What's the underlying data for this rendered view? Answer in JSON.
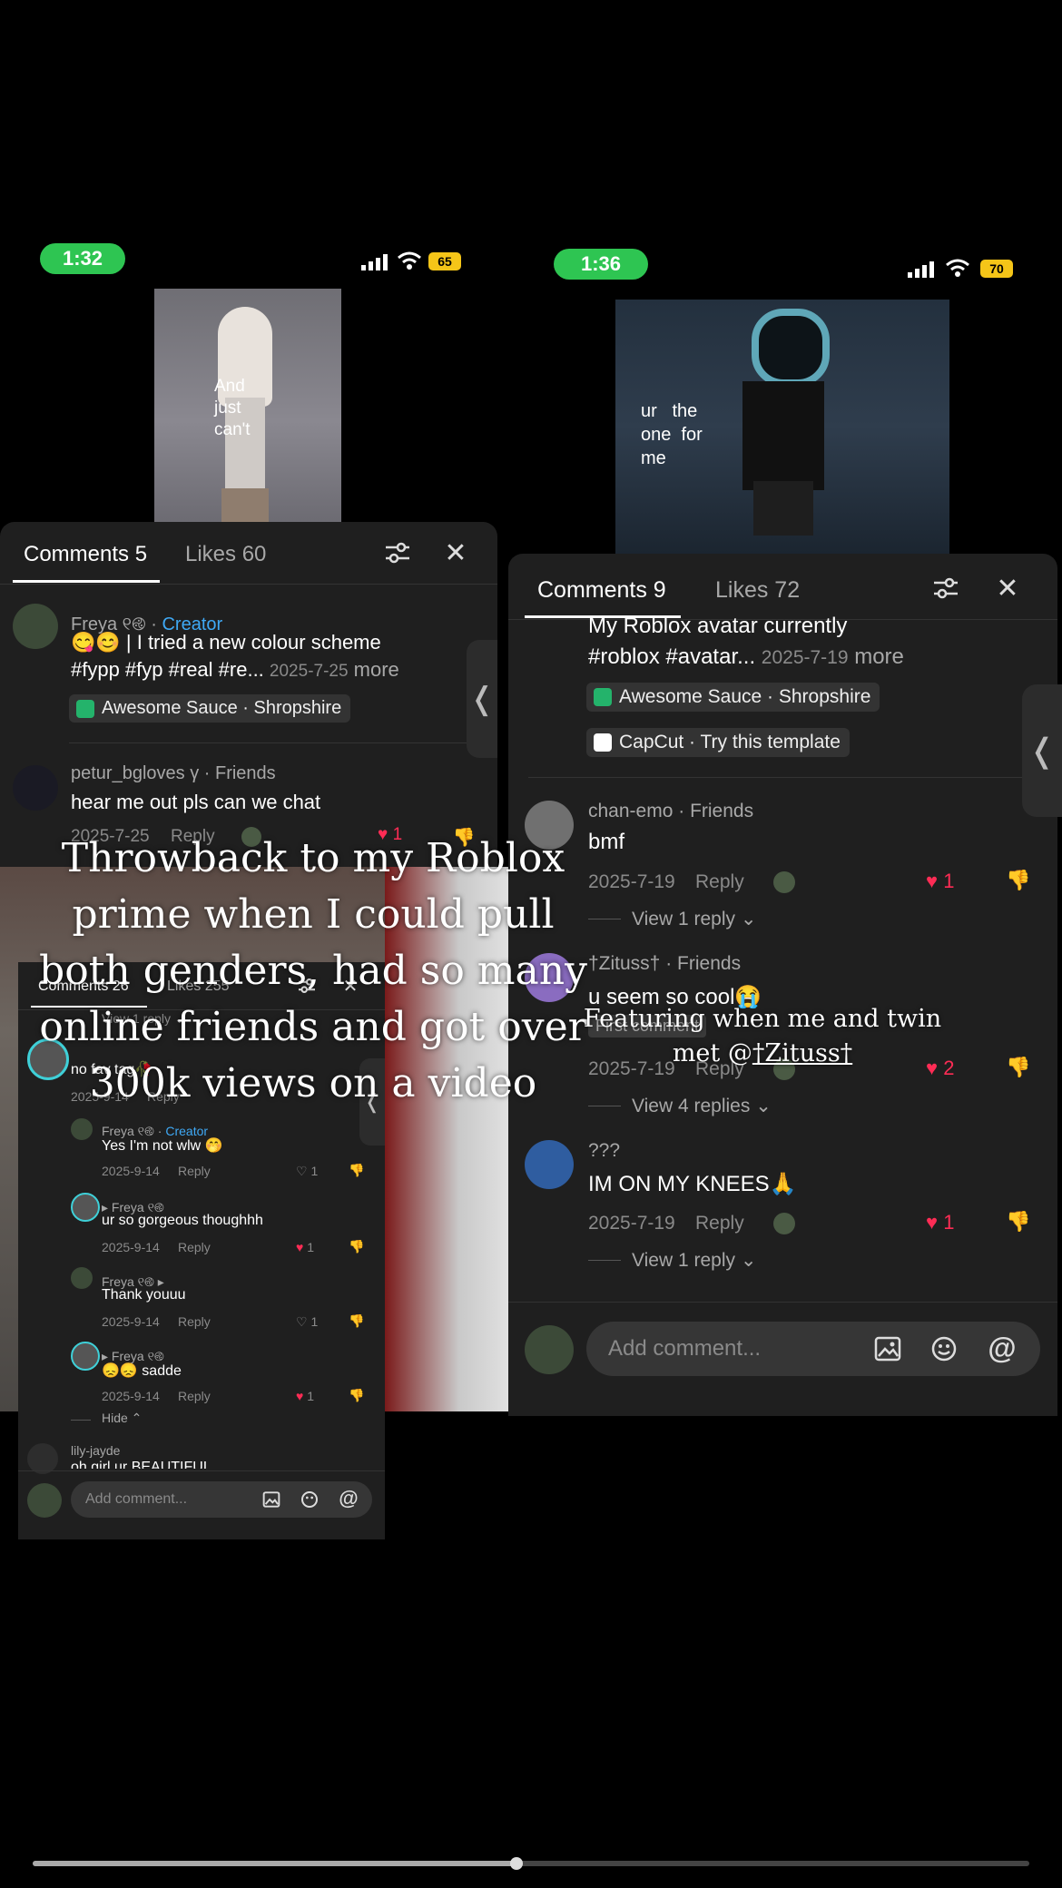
{
  "left_phone": {
    "time": "1:32",
    "battery": "65",
    "video_caption": [
      "And",
      "just",
      "can't"
    ],
    "tabs": {
      "comments": "Comments 5",
      "likes": "Likes 60"
    },
    "comments": [
      {
        "user": "Freya ୧࿋",
        "badge": "Creator",
        "text": "😋😊 | I tried a new colour scheme",
        "text2": "#fypp #fyp #real #re...",
        "date": "2025-7-25",
        "more": "more",
        "chip": "Awesome Sauce · Shropshire"
      },
      {
        "user": "petur_bgloves γ",
        "badge": "Friends",
        "text": "hear me out pls can we chat",
        "date": "2025-7-25",
        "reply": "Reply",
        "likes": "1"
      }
    ]
  },
  "right_phone": {
    "time": "1:36",
    "battery": "70",
    "video_caption": [
      "ur",
      "the",
      "one",
      "for",
      "me"
    ],
    "tabs": {
      "comments": "Comments 9",
      "likes": "Likes 72"
    },
    "top_comment": {
      "line1": "My Roblox avatar currently",
      "line2": "#roblox #avatar...",
      "date": "2025-7-19",
      "more": "more",
      "chip1": "Awesome Sauce · Shropshire",
      "chip2": "CapCut · Try this template"
    },
    "comments": [
      {
        "user": "chan-emo",
        "badge": "Friends",
        "text": "bmf",
        "date": "2025-7-19",
        "reply": "Reply",
        "likes": "1",
        "view_replies": "View 1 reply"
      },
      {
        "user": "†Zituss†",
        "badge": "Friends",
        "text": "u seem so cool😭",
        "tag": "First comment",
        "date": "2025-7-19",
        "reply": "Reply",
        "likes": "2",
        "view_replies": "View 4 replies"
      },
      {
        "user": "???",
        "text": "IM ON MY KNEES🙏",
        "date": "2025-7-19",
        "reply": "Reply",
        "likes": "1",
        "view_replies": "View 1 reply"
      }
    ],
    "add_comment_placeholder": "Add comment..."
  },
  "small_phone": {
    "tabs": {
      "comments": "Comments 26",
      "likes": "Likes 255"
    },
    "view_reply": "View 1 reply",
    "main_comment": {
      "text": "no fav tag🥀",
      "date": "2025-9-14",
      "reply": "Reply"
    },
    "replies": [
      {
        "user": "Freya ୧࿋",
        "badge": "Creator",
        "text": "Yes I'm not wlw 🤭",
        "date": "2025-9-14",
        "reply": "Reply",
        "likes": "1"
      },
      {
        "user": "▸ Freya ୧࿋",
        "text": "ur so gorgeous thoughhh",
        "date": "2025-9-14",
        "reply": "Reply",
        "likes": "1"
      },
      {
        "user": "Freya ୧࿋ ▸",
        "text": "Thank youuu",
        "date": "2025-9-14",
        "reply": "Reply",
        "likes": "1"
      },
      {
        "user": "▸ Freya ୧࿋",
        "text": "😞😞 sadde",
        "date": "2025-9-14",
        "reply": "Reply",
        "likes": "1"
      }
    ],
    "hide": "Hide",
    "last_user": "lily-jayde",
    "last_text": "oh girl ur BEAUTIFUL",
    "add_comment_placeholder": "Add comment..."
  },
  "overlay": {
    "main_caption": "Throwback to my Roblox prime when I could pull both genders, had so many online friends and got over 300k views on a video",
    "secondary_caption_line1": "Featuring when me and twin",
    "secondary_caption_prefix": "met @",
    "secondary_caption_mention": "†Zituss†"
  },
  "progress": {
    "fraction": 0.485
  },
  "colors": {
    "accent_green": "#2ec552",
    "heart": "#fe2c55",
    "creator_blue": "#3fa9f5",
    "sheet_bg": "#1f1f1f"
  }
}
